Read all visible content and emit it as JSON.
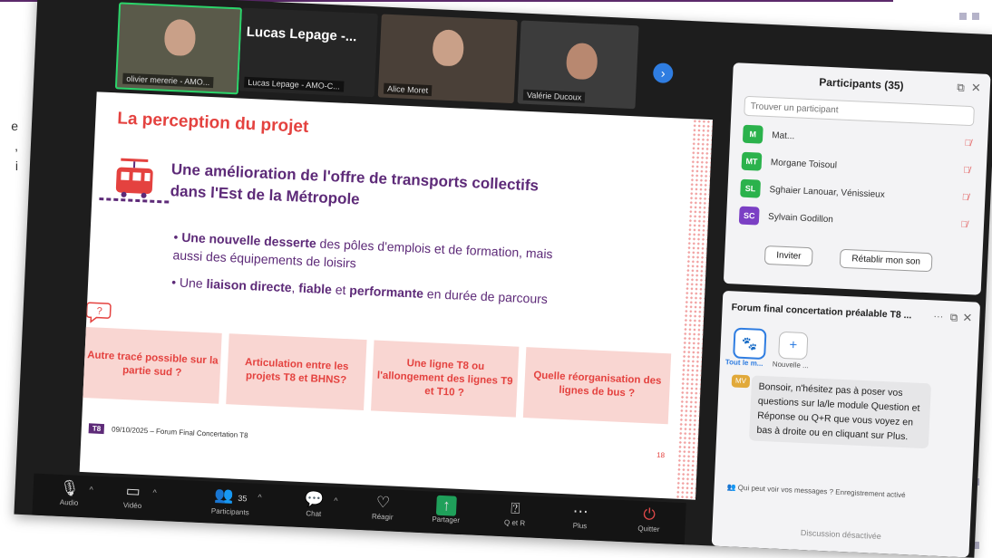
{
  "left_snippet": [
    "e",
    ",",
    "i"
  ],
  "video": {
    "tiles": [
      {
        "label": "olivier mererie - AMO..."
      },
      {
        "name": "Lucas Lepage -...",
        "label": "Lucas Lepage - AMO-C..."
      },
      {
        "label": "Alice Moret"
      },
      {
        "label": "Valérie Ducoux"
      }
    ]
  },
  "slide": {
    "title": "La perception du projet",
    "headline": [
      "Une amélioration de l'offre de transports collectifs",
      "dans l'Est de la Métropole"
    ],
    "bullet1": {
      "strong": "Une nouvelle desserte",
      "rest1": " des pôles d'emplois et de formation, mais",
      "line2": "aussi des équipements de loisirs"
    },
    "bullet2": {
      "pre": "Une ",
      "s1": "liaison directe",
      "m1": ", ",
      "s2": "fiable",
      "m2": " et ",
      "s3": "performante",
      "post": " en durée de parcours"
    },
    "questions": [
      "Autre tracé possible sur la partie sud ?",
      "Articulation entre les projets T8 et BHNS?",
      "Une ligne T8 ou l'allongement des lignes T9 et T10 ?",
      "Quelle réorganisation des lignes de bus ?"
    ],
    "footer_tag": "T8",
    "footer_text": "09/10/2025 – Forum Final Concertation T8",
    "page_number": "18"
  },
  "toolbar": {
    "audio": "Audio",
    "video": "Vidéo",
    "participants": "Participants",
    "participants_count": "35",
    "chat": "Chat",
    "react": "Réagir",
    "share": "Partager",
    "qa": "Q et R",
    "more": "Plus",
    "leave": "Quitter"
  },
  "participants": {
    "title": "Participants (35)",
    "search_placeholder": "Trouver un participant",
    "rows": [
      {
        "initials": "M",
        "name": "Mat...",
        "color": "#2bb24c"
      },
      {
        "initials": "MT",
        "name": "Morgane Toisoul",
        "color": "#2bb24c"
      },
      {
        "initials": "SL",
        "name": "Sghaier Lanouar, Vénissieux",
        "color": "#2bb24c"
      },
      {
        "initials": "SC",
        "name": "Sylvain Godillon",
        "color": "#7b3fc4"
      }
    ],
    "invite": "Inviter",
    "restore_sound": "Rétablir mon son"
  },
  "chat": {
    "title": "Forum final concertation préalable T8 ...",
    "more": "···",
    "tab_all": "Tout le m...",
    "tab_new": "Nouvelle ...",
    "avatar": "MV",
    "message": "Bonsoir, n'hésitez pas à poser vos questions sur la/le module Question et Réponse ou Q+R que vous voyez en bas à droite ou en cliquant sur Plus.",
    "who_can_see": "Qui peut voir vos messages ? Enregistrement activé",
    "disabled": "Discussion désactivée"
  },
  "colors": {
    "brand_purple": "#5d2a78",
    "brand_red": "#e4423f",
    "box_pink": "#f9d6d2",
    "zoom_blue": "#2f7de1",
    "zoom_green": "#2bd46a"
  }
}
